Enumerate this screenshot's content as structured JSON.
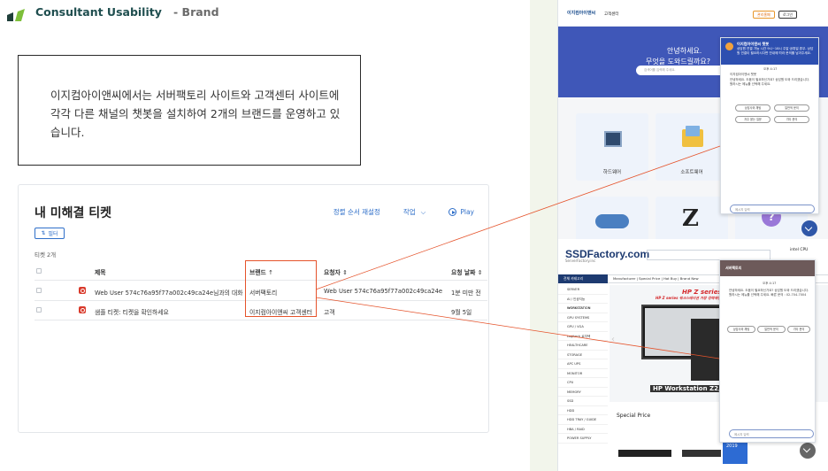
{
  "header": {
    "title": "Consultant Usability",
    "subtitle": "- Brand"
  },
  "description": "이지컴아이앤씨에서는 서버팩토리 사이트와 고객센터 사이트에 각각 다른 채널의 챗봇을 설치하여 2개의 브랜드를 운영하고 있습니다.",
  "tickets": {
    "title": "내 미해결 티켓",
    "sort_label": "정렬 순서 재설정",
    "actions_label": "작업",
    "play_label": "Play",
    "filter_label": "필터",
    "count_label": "티켓 2개",
    "columns": {
      "subject": "제목",
      "brand": "브랜드",
      "requester": "요청자",
      "requested": "요청 날짜"
    },
    "rows": [
      {
        "subject": "Web User 574c76a95f77a002c49ca24e님과의 대화",
        "brand": "서버팩토리",
        "requester": "Web User 574c76a95f77a002c49ca24e",
        "date": "1분 미만 전"
      },
      {
        "subject": "샘플 티켓: 티켓을 확인하세요",
        "brand": "이지컴아이앤씨 고객센터",
        "requester": "고객",
        "date": "9월 5일"
      }
    ]
  },
  "customer_center": {
    "logo_text": "이지컴아이앤씨",
    "center_label": "고객센터",
    "btn_login": "관리홈페",
    "btn_join": "로그인",
    "hero_line1": "안녕하세요.",
    "hero_line2": "무엇을 도와드릴까요?",
    "search_placeholder": "검색어를 입력해 주세요.",
    "tiles": [
      "하드웨어",
      "소프트웨어"
    ],
    "tile_z": "Z",
    "tile_help": "?",
    "chat": {
      "title": "이지컴아이앤씨 챗봇",
      "header_text": "상담원 연결 가능 시간 9시~18시 주말·공휴일 휴무. 상담원 연결이 필요하시다면 안내에 따라 문의를 남겨주세요.",
      "time": "오후 4:17",
      "bot_name": "이지컴아이앤씨 챗봇",
      "message": "안녕하세요. 도움이 필요하신가요? 상담원 도와 드리겠습니다. 원하시는 메뉴를 선택해 주세요.",
      "chips": [
        "상담사와 채팅",
        "일반적 문의",
        "자주 묻는 질문",
        "기타 문의"
      ],
      "input_placeholder": "메시지 입력"
    }
  },
  "server_factory": {
    "logo": "SSDFactory.com",
    "sub": "ServerFactory.inc",
    "cart_label": "intel CPU",
    "all_categories": "전체 카테고리",
    "nav": "Manufacturer | Special Price | Hot Buy | Brand New",
    "categories": [
      "SERVER",
      "AI / 인공지능 WORKSTATION",
      "WORKSTATION",
      "GPU SYSTEMS",
      "GPU / VGA",
      "Logitech 로지텍",
      "HEALTHCARE",
      "STORAGE",
      "APC UPS",
      "MONITOR",
      "CPU",
      "MEMORY",
      "SSD",
      "HDD",
      "HDD TRAY / GUIDE",
      "HBA / RAID",
      "POWER SUPPLY"
    ],
    "banner_title": "HP Z series Workstation",
    "banner_sub": "HP Z series 워크스테이션 가장 강력해진 성능",
    "banner_product": "HP Workstation Z2, Z4, Z6",
    "special": "Special Price",
    "win_label": "Server 2019",
    "chat": {
      "title": "서버팩토리",
      "time": "오후 4:17",
      "message": "안녕하세요. 도움이 필요하신가요? 상담원 도와 드리겠습니다. 원하시는 메뉴를 선택해 주세요. 빠른 문의 : 02-704-7004",
      "chips": [
        "상담사와 채팅",
        "일반적 문의",
        "기타 문의"
      ],
      "input_placeholder": "메시지 입력"
    }
  },
  "colors": {
    "accent": "#e5532b",
    "link": "#2f6fc9",
    "title": "#1f4e4f"
  }
}
